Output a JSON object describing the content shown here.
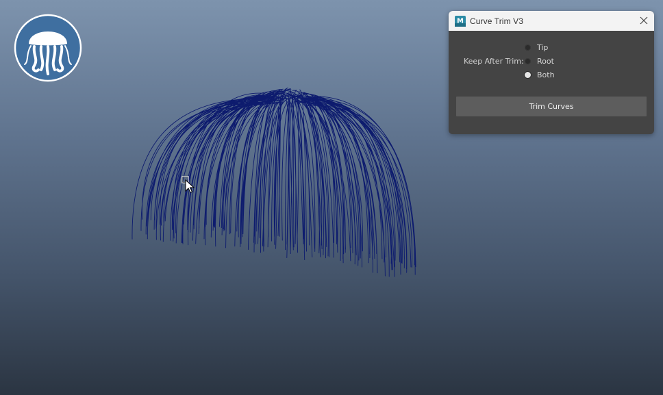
{
  "dialog": {
    "title": "Curve Trim V3",
    "keep_label": "Keep After Trim:",
    "options": [
      {
        "label": "Tip",
        "checked": false
      },
      {
        "label": "Root",
        "checked": false
      },
      {
        "label": "Both",
        "checked": true
      }
    ],
    "trim_button_label": "Trim Curves",
    "app_icon_text": "M"
  },
  "colors": {
    "curves": "#0d1b6e",
    "dialog_bg": "#444444",
    "titlebar_bg": "#f3f3f3",
    "button_bg": "#5d5d5d",
    "logo_bg": "#3f6fa0"
  },
  "icons": [
    "jellyfish-logo-icon",
    "maya-app-icon",
    "close-icon",
    "mouse-cursor-icon"
  ]
}
